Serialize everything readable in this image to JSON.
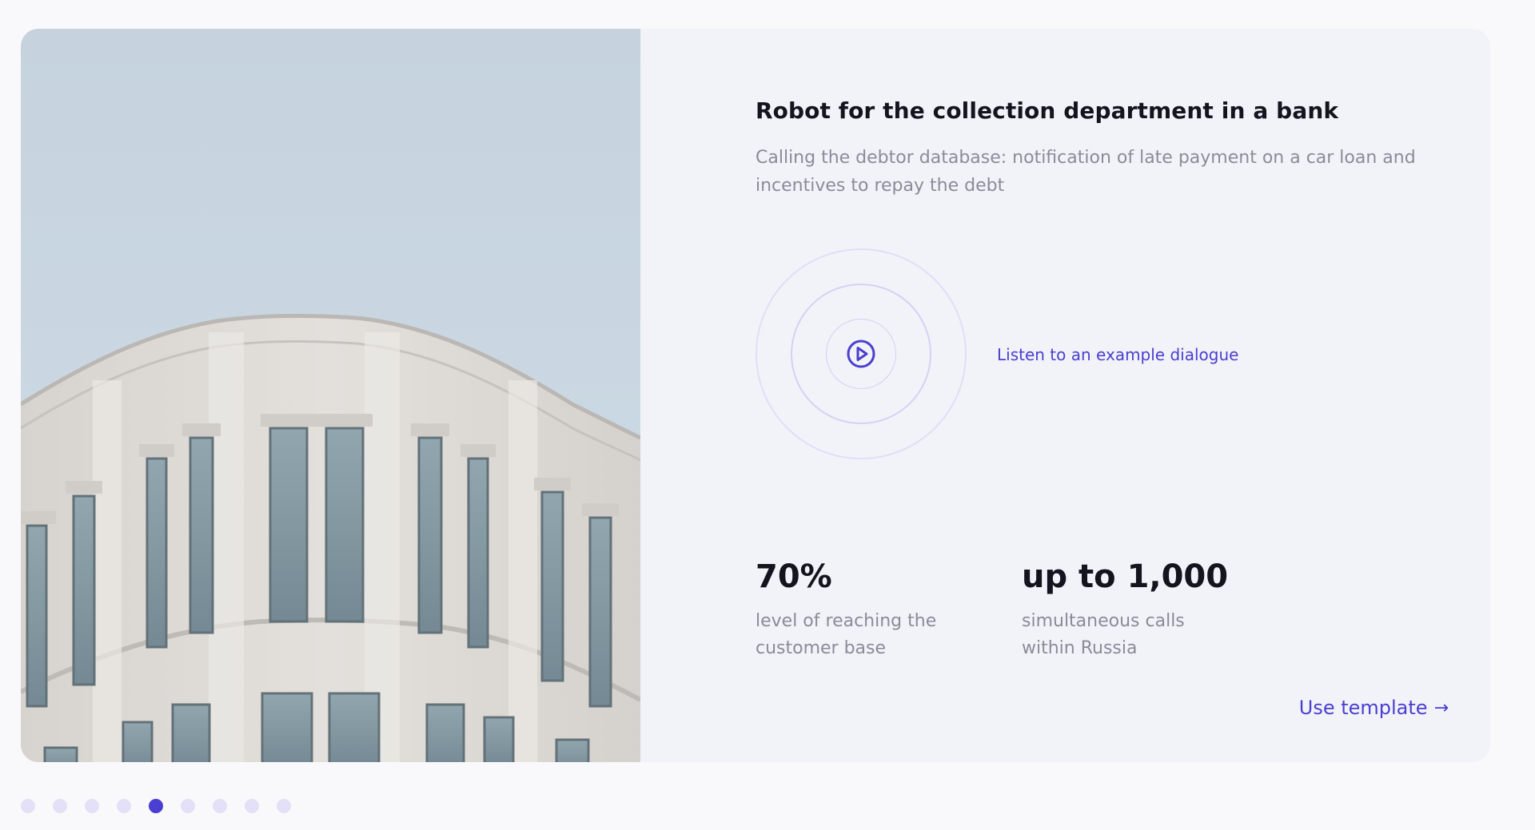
{
  "card": {
    "title": "Robot for the collection department in a bank",
    "subtitle": "Calling the debtor database: notification of late payment on a car loan and incentives to repay the debt",
    "listen_label": "Listen to an example dialogue",
    "stats": [
      {
        "value": "70%",
        "label": "level of reaching the customer base"
      },
      {
        "value": "up to 1,000",
        "label": "simultaneous calls within Russia"
      }
    ],
    "cta_label": "Use template",
    "cta_icon": "arrow-right-icon",
    "play_icon": "play-circle-icon"
  },
  "carousel": {
    "total_slides": 9,
    "active_index": 4
  },
  "colors": {
    "accent": "#4a3fd0",
    "title": "#14141f",
    "muted": "#8b8b9a",
    "card_bg": "#f2f3f8",
    "page_bg": "#f9f9fb",
    "dot_inactive": "#e3e0f8"
  }
}
